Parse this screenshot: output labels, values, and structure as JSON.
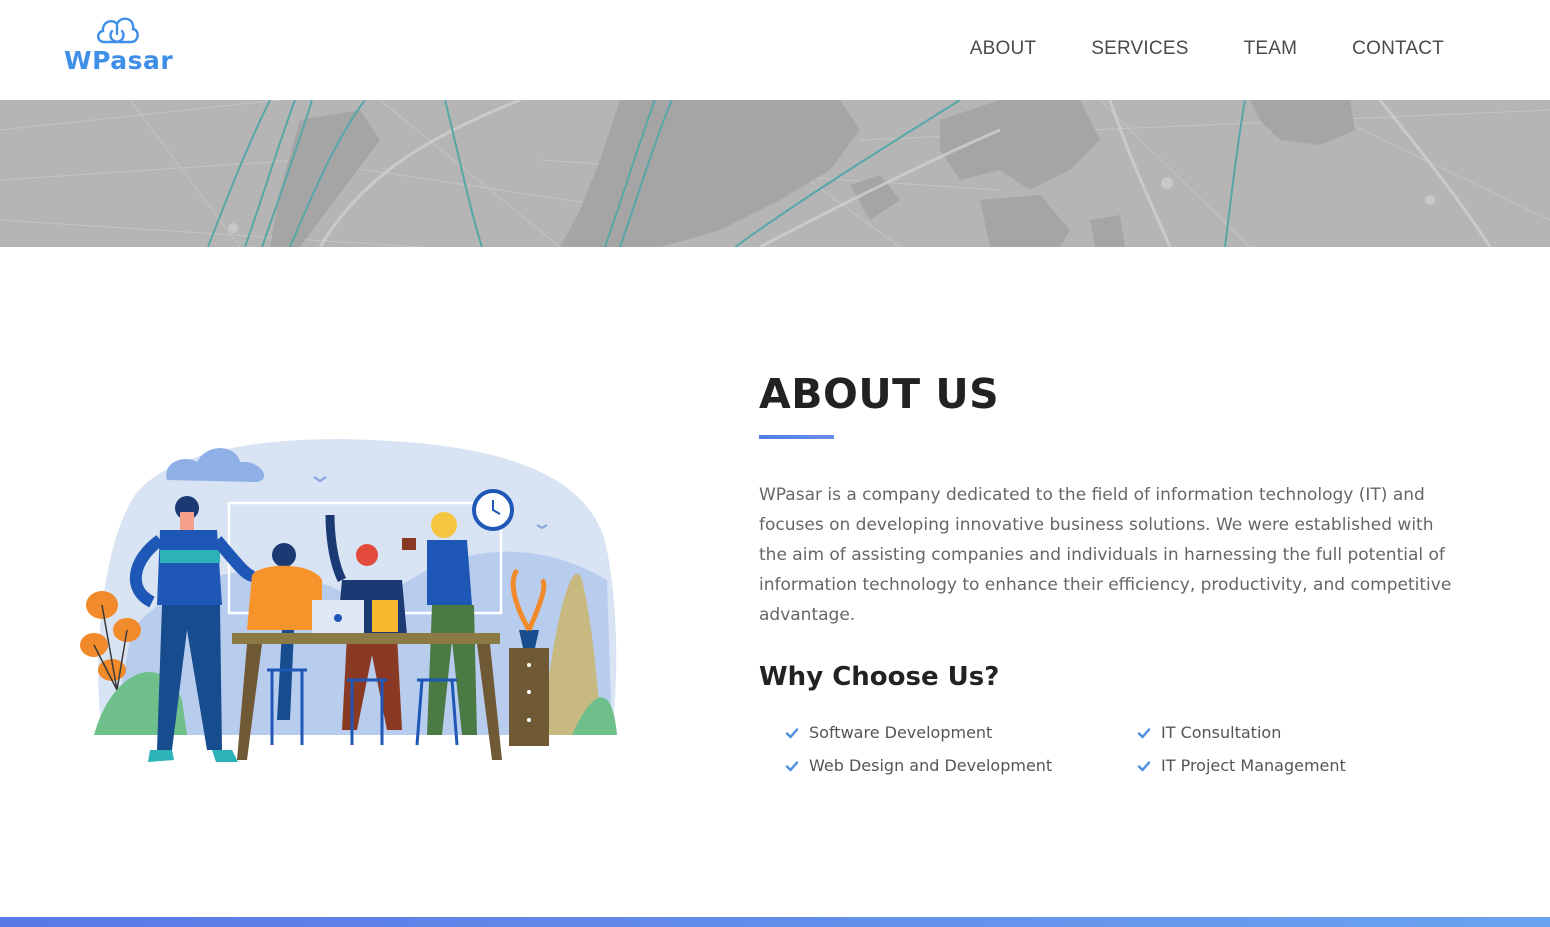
{
  "brand": {
    "name": "WPasar",
    "logo_icon": "cloud-power-icon",
    "color": "#3f8ee8"
  },
  "nav": {
    "items": [
      {
        "label": "ABOUT"
      },
      {
        "label": "SERVICES"
      },
      {
        "label": "TEAM"
      },
      {
        "label": "CONTACT"
      }
    ]
  },
  "about": {
    "title": "ABOUT US",
    "description": "WPasar is a company dedicated to the field of information technology (IT) and focuses on developing innovative business solutions. We were established with the aim of assisting companies and individuals in harnessing the full potential of information technology to enhance their efficiency, productivity, and competitive advantage.",
    "why_title": "Why Choose Us?",
    "features": [
      {
        "label": "Software Development",
        "icon": "check-icon"
      },
      {
        "label": "IT Consultation",
        "icon": "check-icon"
      },
      {
        "label": "Web Design and Development",
        "icon": "check-icon"
      },
      {
        "label": "IT Project Management",
        "icon": "check-icon"
      }
    ]
  },
  "colors": {
    "accent": "#4f7fe8",
    "check": "#4a90e2",
    "banner": "#b6b6b6"
  }
}
